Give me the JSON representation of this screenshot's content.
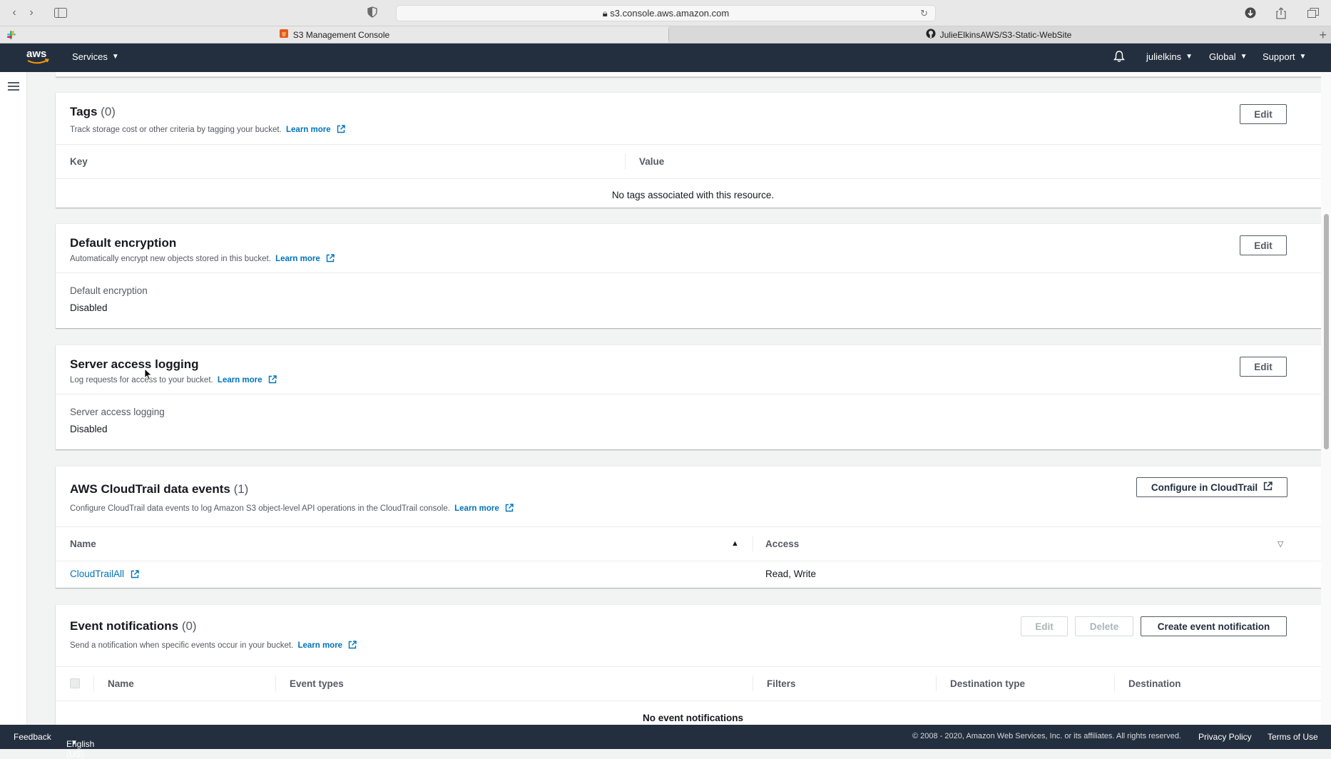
{
  "browser": {
    "url": "s3.console.aws.amazon.com",
    "tabs": [
      {
        "label": "S3 Management Console"
      },
      {
        "label": "JulieElkinsAWS/S3-Static-WebSite"
      }
    ]
  },
  "aws_nav": {
    "services_label": "Services",
    "user_label": "julielkins",
    "region_label": "Global",
    "support_label": "Support"
  },
  "tags": {
    "title": "Tags",
    "count": "(0)",
    "description": "Track storage cost or other criteria by tagging your bucket.",
    "learn_more": "Learn more",
    "edit_label": "Edit",
    "columns": [
      "Key",
      "Value"
    ],
    "empty_text": "No tags associated with this resource."
  },
  "encryption": {
    "title": "Default encryption",
    "description": "Automatically encrypt new objects stored in this bucket.",
    "learn_more": "Learn more",
    "edit_label": "Edit",
    "field_label": "Default encryption",
    "field_value": "Disabled"
  },
  "logging": {
    "title": "Server access logging",
    "description": "Log requests for access to your bucket.",
    "learn_more": "Learn more",
    "edit_label": "Edit",
    "field_label": "Server access logging",
    "field_value": "Disabled"
  },
  "cloudtrail": {
    "title": "AWS CloudTrail data events",
    "count": "(1)",
    "description": "Configure CloudTrail data events to log Amazon S3 object-level API operations in the CloudTrail console.",
    "learn_more": "Learn more",
    "configure_label": "Configure in CloudTrail",
    "columns": [
      "Name",
      "Access"
    ],
    "rows": [
      {
        "name": "CloudTrailAll",
        "access": "Read, Write"
      }
    ]
  },
  "events": {
    "title": "Event notifications",
    "count": "(0)",
    "description": "Send a notification when specific events occur in your bucket.",
    "learn_more": "Learn more",
    "edit_label": "Edit",
    "delete_label": "Delete",
    "create_label": "Create event notification",
    "columns": [
      "Name",
      "Event types",
      "Filters",
      "Destination type",
      "Destination"
    ],
    "empty_text": "No event notifications"
  },
  "footer": {
    "feedback": "Feedback",
    "language": "English (US)",
    "copyright": "© 2008 - 2020, Amazon Web Services, Inc. or its affiliates. All rights reserved.",
    "privacy": "Privacy Policy",
    "terms": "Terms of Use"
  },
  "colors": {
    "nav_bg": "#232f3e",
    "link": "#0073bb",
    "page_bg": "#f2f3f3"
  }
}
